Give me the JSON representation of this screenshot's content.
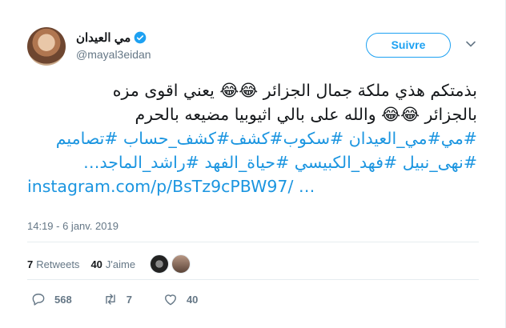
{
  "user": {
    "display_name": "مي العيدان",
    "handle": "@mayal3eidan"
  },
  "follow_button": {
    "label": "Suivre"
  },
  "tweet": {
    "lines": [
      "بذمتكم هذي ملكة جمال الجزائر 😂😂 يعني اقوى مزه",
      "بالجزائر 😂😂 والله على بالي اثيوبيا مضيعه بالحرم",
      "#مي#مي_العيدان #سكوب#كشف#كشف_حساب #تصاميم",
      "#نهى_نبيل #فهد_الكبيسي #حياة_الفهد #راشد_الماجد…",
      "instagram.com/p/BsTz9cPBW97/  …"
    ],
    "timestamp": "14:19 - 6 janv. 2019"
  },
  "stats": {
    "retweets_count": "7",
    "retweets_label": "Retweets",
    "likes_count": "40",
    "likes_label": "J'aime"
  },
  "actions": {
    "replies": "568",
    "retweets": "7",
    "likes": "40"
  },
  "colors": {
    "accent": "#1da1f2",
    "link": "#1b95e0",
    "muted": "#657786"
  }
}
